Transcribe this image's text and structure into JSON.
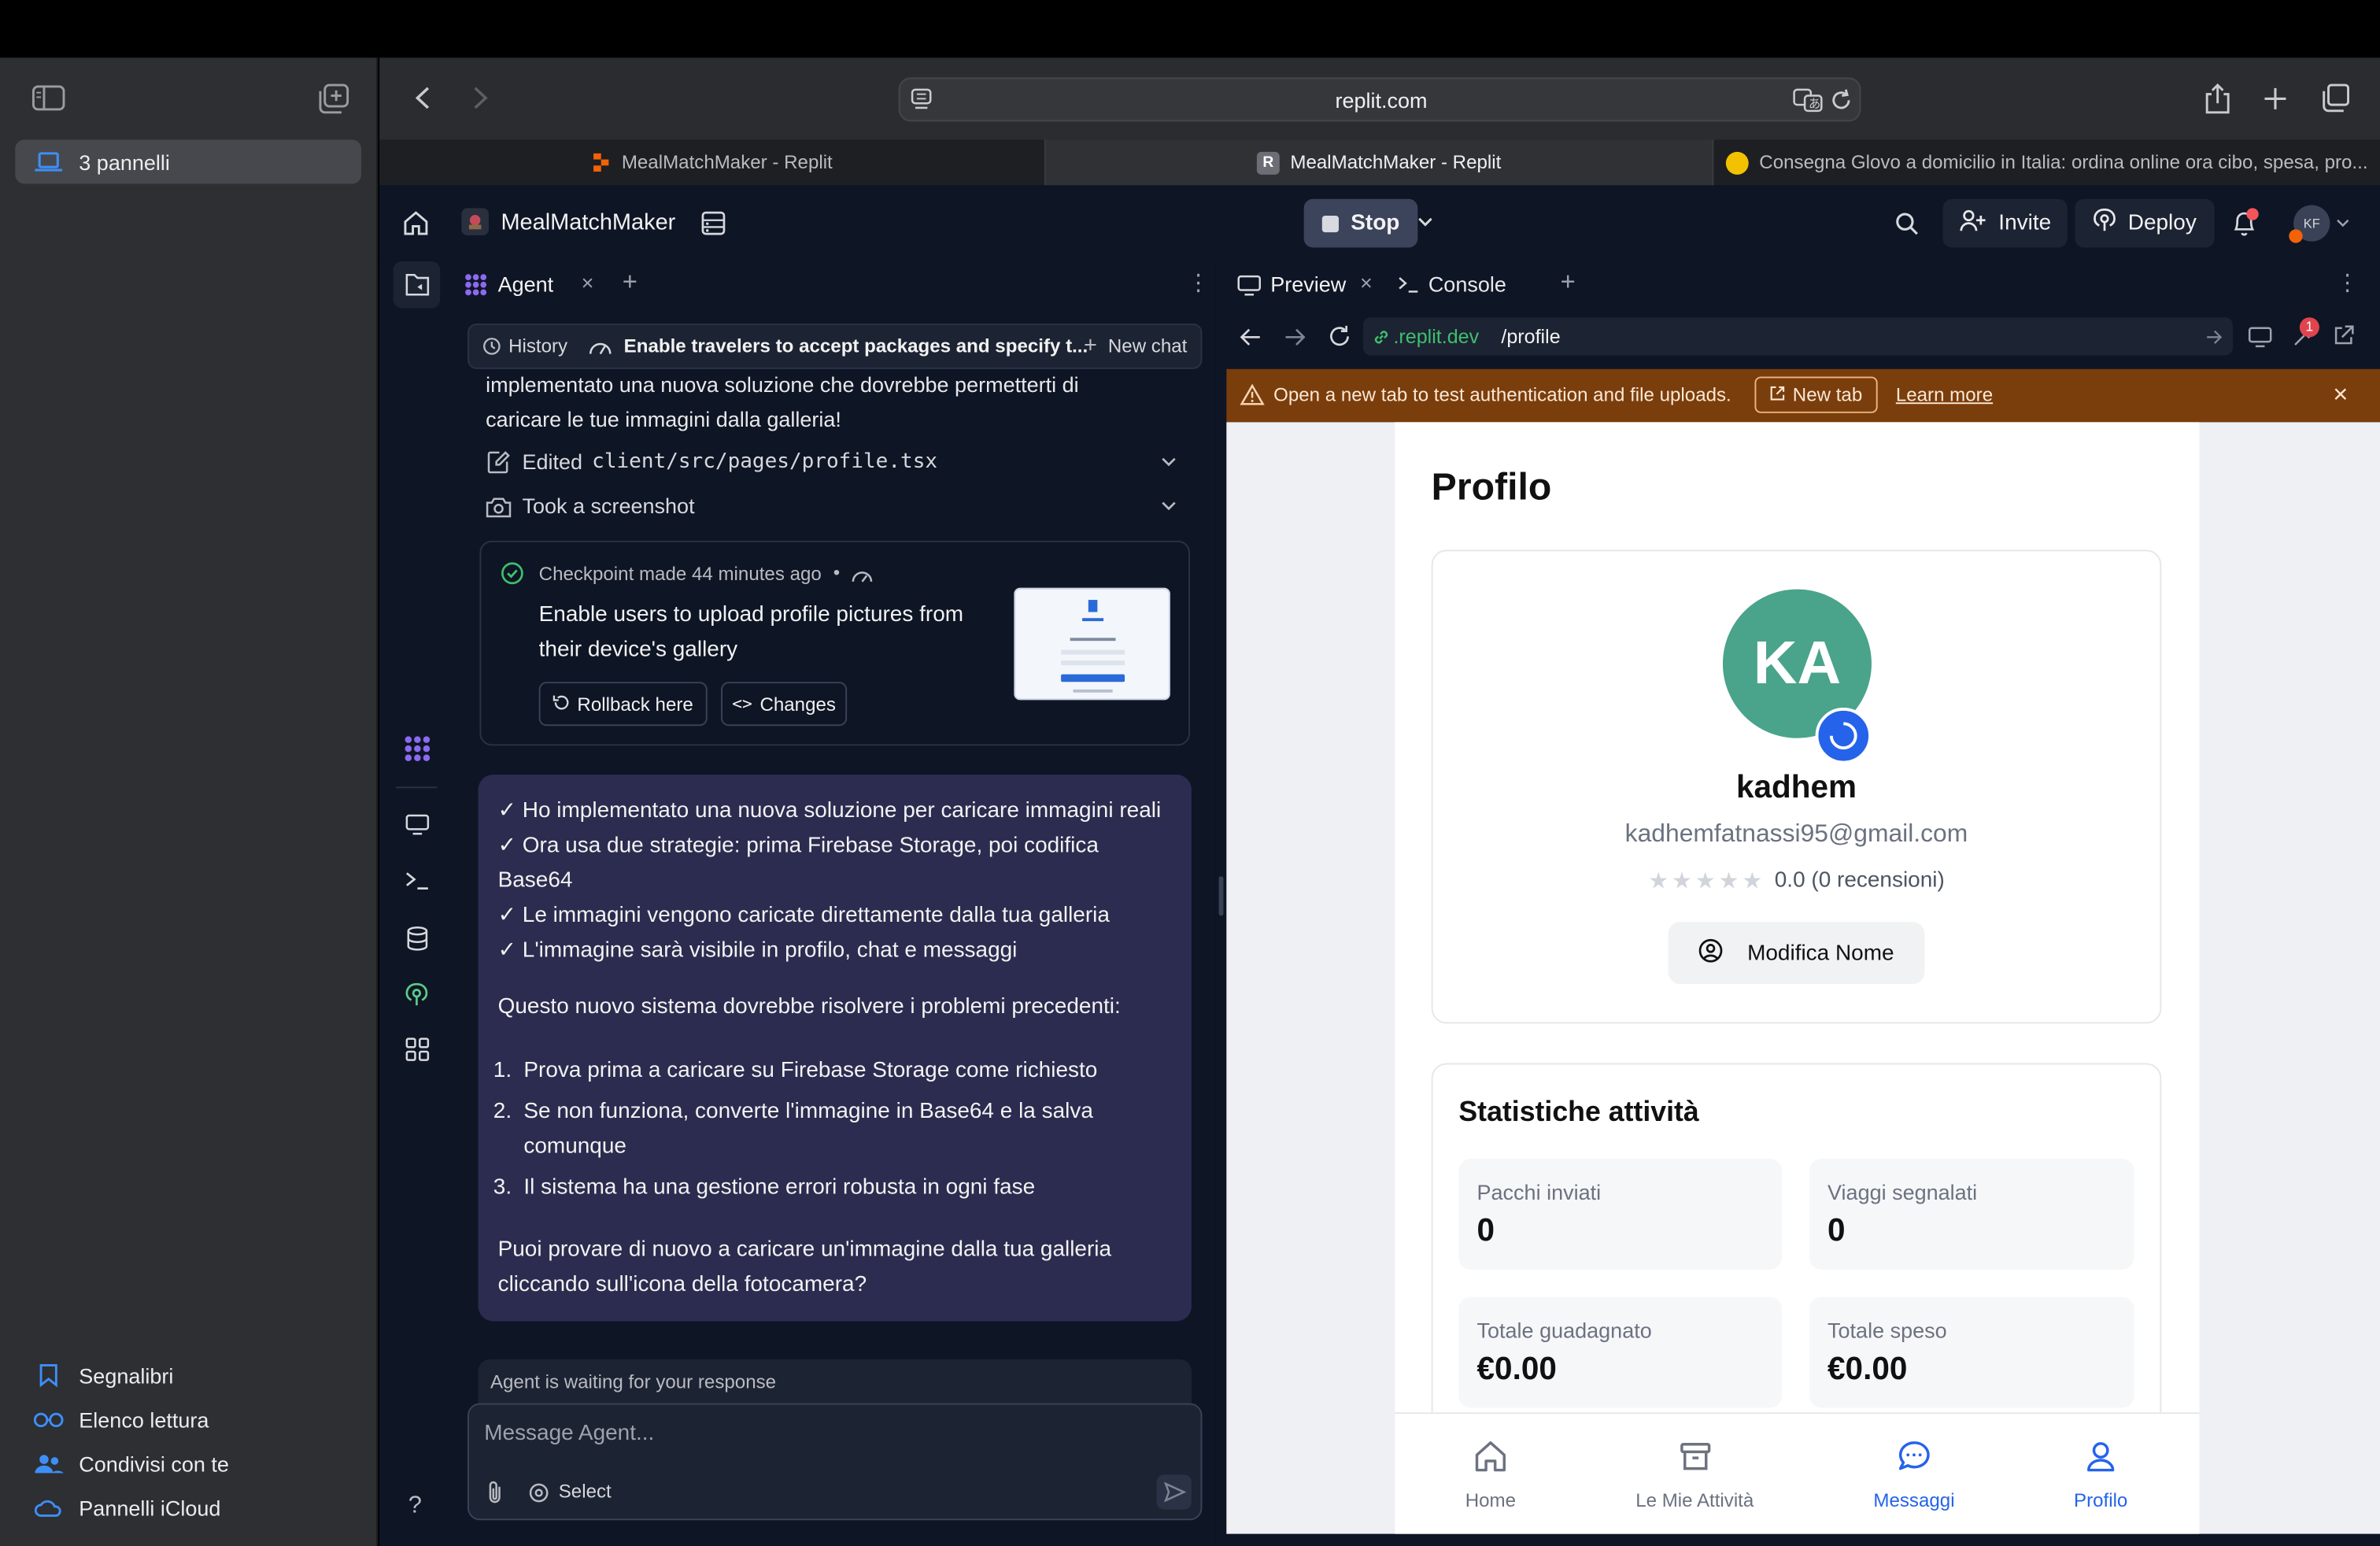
{
  "safari": {
    "sidebar_group": "3 pannelli",
    "sidebar_bottom": [
      "Segnalibri",
      "Elenco lettura",
      "Condivisi con te",
      "Pannelli iCloud"
    ],
    "url": "replit.com",
    "tabs": [
      "MealMatchMaker - Replit",
      "MealMatchMaker - Replit",
      "Consegna Glovo a domicilio in Italia: ordina online ora cibo, spesa, pro..."
    ]
  },
  "replit": {
    "project_name": "MealMatchMaker",
    "stop_label": "Stop",
    "invite_label": "Invite",
    "deploy_label": "Deploy",
    "avatar_initials": "KF",
    "notif_badge": "1"
  },
  "agent": {
    "tab_label": "Agent",
    "history_label": "History",
    "chat_title": "Enable travelers to accept packages and specify t...",
    "new_chat_label": "New chat",
    "prev_text_1": "implementato una nuova soluzione che dovrebbe permetterti di",
    "prev_text_2": "caricare le tue immagini dalla galleria!",
    "edited_label": "Edited",
    "edited_file": "client/src/pages/profile.tsx",
    "screenshot_label": "Took a screenshot",
    "checkpoint_label": "Checkpoint made 44 minutes ago",
    "checkpoint_dot": "•",
    "checkpoint_desc_1": "Enable users to upload profile pictures from",
    "checkpoint_desc_2": "their device's gallery",
    "rollback_label": "Rollback here",
    "changes_label": "Changes",
    "msg": {
      "checks": [
        "✓ Ho implementato una nuova soluzione per caricare immagini reali",
        "✓ Ora usa due strategie: prima Firebase Storage, poi codifica",
        "Base64",
        "✓ Le immagini vengono caricate direttamente dalla tua galleria",
        "✓ L'immagine sarà visibile in profilo, chat e messaggi"
      ],
      "intro": "Questo nuovo sistema dovrebbe risolvere i problemi precedenti:",
      "items": [
        {
          "num": "1.",
          "text": "Prova prima a caricare su Firebase Storage come richiesto"
        },
        {
          "num": "2.",
          "text": "Se non funziona, converte l'immagine in Base64 e la salva"
        },
        {
          "num": "",
          "text": "comunque"
        },
        {
          "num": "3.",
          "text": "Il sistema ha una gestione errori robusta in ogni fase"
        }
      ],
      "outro_1": "Puoi provare di nuovo a caricare un'immagine dalla tua galleria",
      "outro_2": "cliccando sull'icona della fotocamera?"
    },
    "waiting": "Agent is waiting for your response",
    "input_placeholder": "Message Agent...",
    "select_label": "Select"
  },
  "preview": {
    "tab_preview": "Preview",
    "tab_console": "Console",
    "url_domain": ".replit.dev",
    "url_path": "/profile",
    "devtools_badge": "1",
    "banner_text": "Open a new tab to test authentication and file uploads.",
    "banner_newtab": "New tab",
    "banner_learn": "Learn more"
  },
  "profile": {
    "title": "Profilo",
    "initials": "KA",
    "name": "kadhem",
    "email": "kadhemfatnassi95@gmail.com",
    "rating_stars": "★★★★★",
    "rating_value": 0.0,
    "rating_text": "0.0 (0 recensioni)",
    "edit_button": "Modifica Nome",
    "stats_title": "Statistiche attività",
    "stats": [
      {
        "label": "Pacchi inviati",
        "value": "0"
      },
      {
        "label": "Viaggi segnalati",
        "value": "0"
      },
      {
        "label": "Totale guadagnato",
        "value": "€0.00"
      },
      {
        "label": "Totale speso",
        "value": "€0.00"
      }
    ],
    "nav": [
      "Home",
      "Le Mie Attività",
      "Messaggi",
      "Profilo"
    ]
  },
  "colors": {
    "accent": "#2563eb",
    "avatar": "#4aa38b",
    "banner": "#7a3d0c",
    "agent_bubble": "#2b2c4f"
  }
}
